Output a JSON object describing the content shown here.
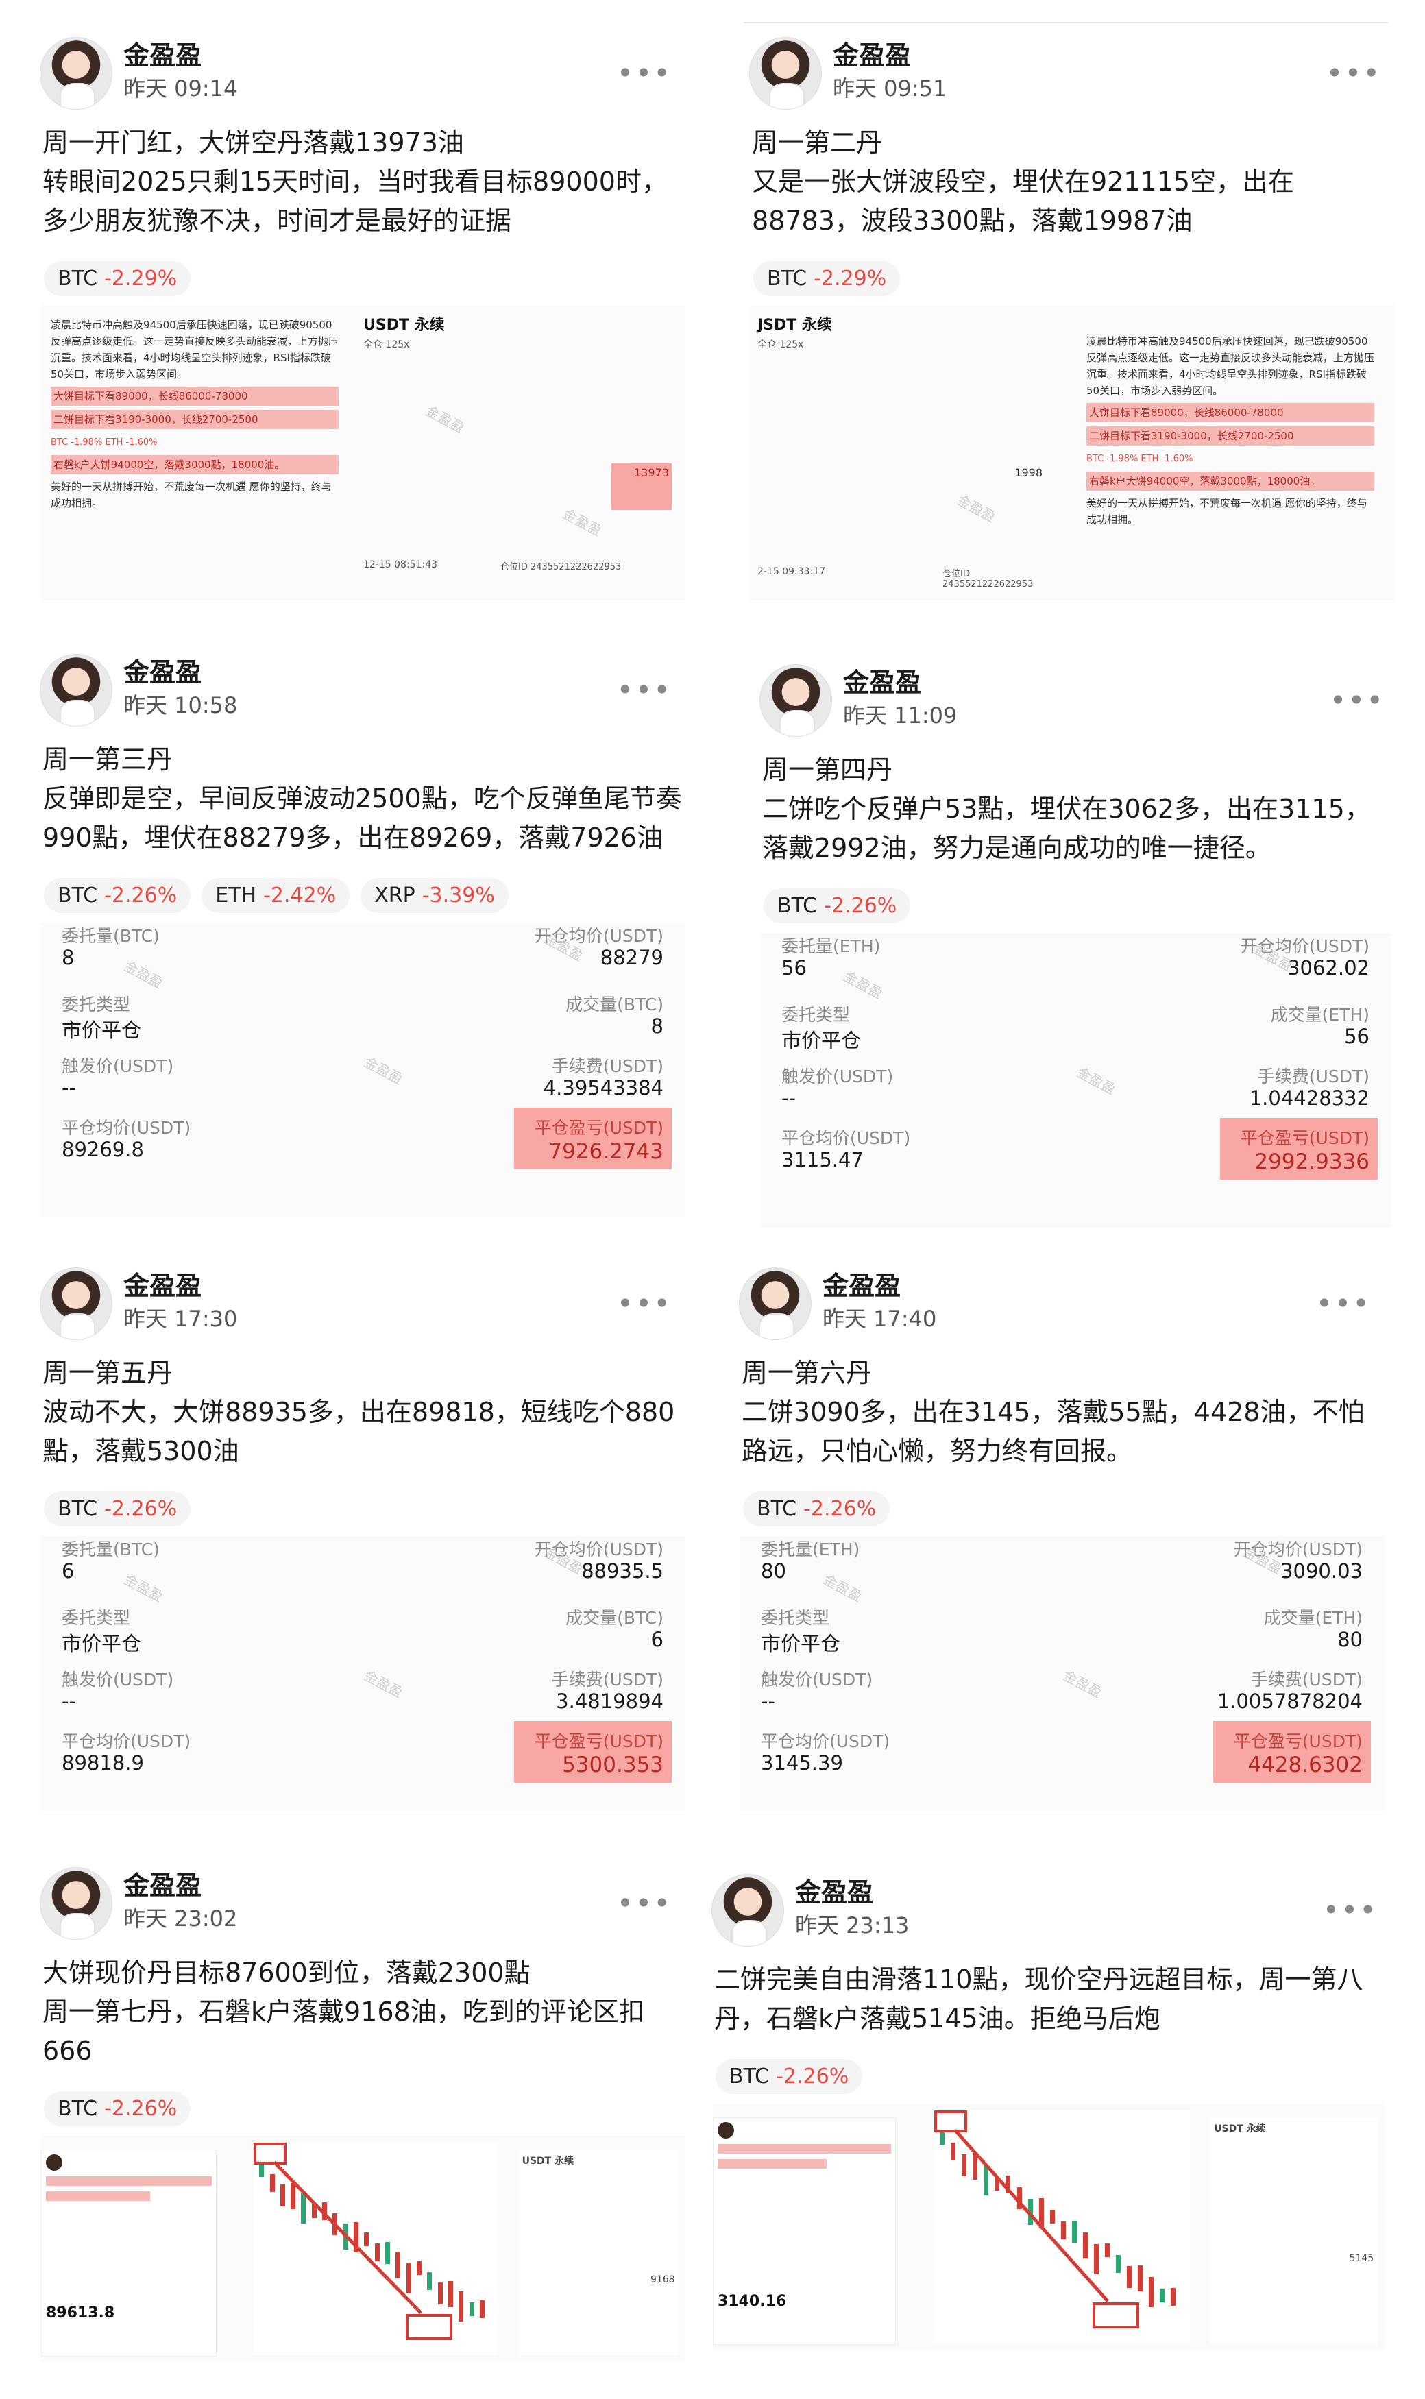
{
  "posts": [
    {
      "user": "金盈盈",
      "time": "昨天 09:14",
      "lines": [
        "周一开门红，大饼空丹落戴13973油",
        "转眼间2025只剩15天时间，当时我看目标89000时，多少朋友犹豫不决，时间才是最好的证据"
      ],
      "tags": [
        {
          "sym": "BTC",
          "chg": "-2.29%"
        }
      ],
      "shot": {
        "news_text": "凌晨比特币冲高触及94500后承压快速回落，现已跌破90500反弹高点逐级走低。这一走势直接反映多头动能衰减，上方抛压沉重。技术面来看，4小时均线呈空头排列迹象，RSI指标跌破50关口，市场步入弱势区间。",
        "news_hl1": "大饼目标下看89000，长线86000-78000",
        "news_hl2": "二饼目标下看3190-3000，长线2700-2500",
        "ticker_line": "BTC -1.98%   ETH -1.60%",
        "hl3": "右磐k户大饼94000空，落戴3000點，18000油。",
        "footer": "美好的一天从拼搏开始，不荒废每一次机遇 愿你的坚持，终与成功相拥。",
        "title": "USDT 永续",
        "sub": "全仓 125x",
        "pnl": "13973",
        "stamp": "12-15 08:51:43",
        "order_id": "仓位ID 2435521222622953",
        "watermark": "金盈盈"
      }
    },
    {
      "user": "金盈盈",
      "time": "昨天 09:51",
      "lines": [
        "周一第二丹",
        "又是一张大饼波段空，埋伏在921115空，出在88783，波段3300點，落戴19987油"
      ],
      "tags": [
        {
          "sym": "BTC",
          "chg": "-2.29%"
        }
      ],
      "shot": {
        "news_text": "凌晨比特币冲高触及94500后承压快速回落，现已跌破90500反弹高点逐级走低。这一走势直接反映多头动能衰减，上方抛压沉重。技术面来看，4小时均线呈空头排列迹象，RSI指标跌破50关口，市场步入弱势区间。",
        "news_hl1": "大饼目标下看89000，长线86000-78000",
        "news_hl2": "二饼目标下看3190-3000，长线2700-2500",
        "ticker_line": "BTC -1.98%   ETH -1.60%",
        "hl3": "右磐k户大饼94000空，落戴3000點，18000油。",
        "footer": "美好的一天从拼搏开始，不荒废每一次机遇 愿你的坚持，终与成功相拥。",
        "title": "JSDT 永续",
        "sub": "全仓 125x",
        "pnl": "1998",
        "stamp": "2-15 09:33:17",
        "order_id": "仓位ID 2435521222622953",
        "watermark": "金盈盈"
      }
    },
    {
      "user": "金盈盈",
      "time": "昨天 10:58",
      "lines": [
        "周一第三丹",
        "反弹即是空，早间反弹波动2500點，吃个反弹鱼尾节奏990點，埋伏在88279多，出在89269，落戴7926油"
      ],
      "tags": [
        {
          "sym": "BTC",
          "chg": "-2.26%"
        },
        {
          "sym": "ETH",
          "chg": "-2.42%"
        },
        {
          "sym": "XRP",
          "chg": "-3.39%"
        }
      ],
      "order": {
        "l1": "委托量(BTC)",
        "v1": "8",
        "r1": "开仓均价(USDT)",
        "rv1": "88279",
        "l2": "委托类型",
        "v2": "市价平仓",
        "r2": "成交量(BTC)",
        "rv2": "8",
        "l3": "触发价(USDT)",
        "v3": "--",
        "r3": "手续费(USDT)",
        "rv3": "4.39543384",
        "l4": "平仓均价(USDT)",
        "v4": "89269.8",
        "r4": "平仓盈亏(USDT)",
        "rv4": "7926.2743"
      }
    },
    {
      "user": "金盈盈",
      "time": "昨天 11:09",
      "lines": [
        "周一第四丹",
        "二饼吃个反弹户53點，埋伏在3062多，出在3115，落戴2992油，努力是通向成功的唯一捷径。"
      ],
      "tags": [
        {
          "sym": "BTC",
          "chg": "-2.26%"
        }
      ],
      "order": {
        "l1": "委托量(ETH)",
        "v1": "56",
        "r1": "开仓均价(USDT)",
        "rv1": "3062.02",
        "l2": "委托类型",
        "v2": "市价平仓",
        "r2": "成交量(ETH)",
        "rv2": "56",
        "l3": "触发价(USDT)",
        "v3": "--",
        "r3": "手续费(USDT)",
        "rv3": "1.04428332",
        "l4": "平仓均价(USDT)",
        "v4": "3115.47",
        "r4": "平仓盈亏(USDT)",
        "rv4": "2992.9336"
      }
    },
    {
      "user": "金盈盈",
      "time": "昨天 17:30",
      "lines": [
        "周一第五丹",
        "波动不大，大饼88935多，出在89818，短线吃个880點，落戴5300油"
      ],
      "tags": [
        {
          "sym": "BTC",
          "chg": "-2.26%"
        }
      ],
      "order": {
        "l1": "委托量(BTC)",
        "v1": "6",
        "r1": "开仓均价(USDT)",
        "rv1": "88935.5",
        "l2": "委托类型",
        "v2": "市价平仓",
        "r2": "成交量(BTC)",
        "rv2": "6",
        "l3": "触发价(USDT)",
        "v3": "--",
        "r3": "手续费(USDT)",
        "rv3": "3.4819894",
        "l4": "平仓均价(USDT)",
        "v4": "89818.9",
        "r4": "平仓盈亏(USDT)",
        "rv4": "5300.353"
      }
    },
    {
      "user": "金盈盈",
      "time": "昨天 17:40",
      "lines": [
        "周一第六丹",
        "二饼3090多，出在3145，落戴55點，4428油，不怕路远，只怕心懒，努力终有回报。"
      ],
      "tags": [
        {
          "sym": "BTC",
          "chg": "-2.26%"
        }
      ],
      "order": {
        "l1": "委托量(ETH)",
        "v1": "80",
        "r1": "开仓均价(USDT)",
        "rv1": "3090.03",
        "l2": "委托类型",
        "v2": "市价平仓",
        "r2": "成交量(ETH)",
        "rv2": "80",
        "l3": "触发价(USDT)",
        "v3": "--",
        "r3": "手续费(USDT)",
        "rv3": "1.0057878204",
        "l4": "平仓均价(USDT)",
        "v4": "3145.39",
        "r4": "平仓盈亏(USDT)",
        "rv4": "4428.6302"
      }
    },
    {
      "user": "金盈盈",
      "time": "昨天 23:02",
      "lines": [
        "大饼现价丹目标87600到位，落戴2300點",
        "周一第七丹，石磐k户落戴9168油，吃到的评论区扣666"
      ],
      "tags": [
        {
          "sym": "BTC",
          "chg": "-2.26%"
        }
      ],
      "mini": {
        "price": "89613.8",
        "side_title": "USDT 永续",
        "side_val": "9168"
      }
    },
    {
      "user": "金盈盈",
      "time": "昨天 23:13",
      "lines": [
        "二饼完美自由滑落110點，现价空丹远超目标，周一第八丹，石磐k户落戴5145油。拒绝马后炮"
      ],
      "tags": [
        {
          "sym": "BTC",
          "chg": "-2.26%"
        }
      ],
      "mini": {
        "price": "3140.16",
        "side_title": "USDT 永续",
        "side_val": "5145"
      }
    }
  ],
  "colors": {
    "down_red": "#e8483f",
    "pnl_bg": "#f7a6a3",
    "up_green": "#2aa770"
  }
}
